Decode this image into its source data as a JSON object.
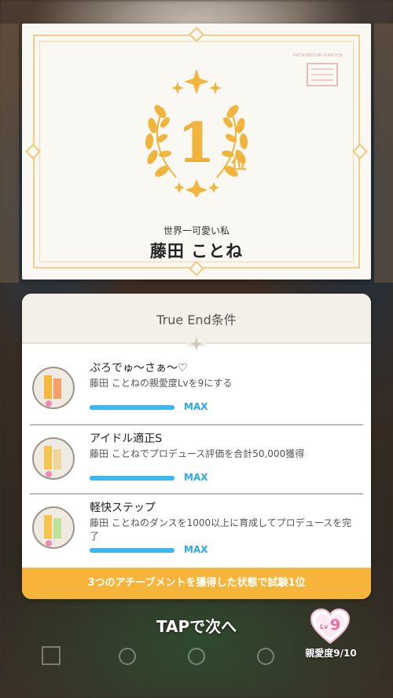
{
  "certificate": {
    "stamp_text": "HATSUBOSHI GAKUEN",
    "rank_number": "1",
    "rank_suffix": "位",
    "subtitle": "世界一可愛い私",
    "name": "藤田 ことね"
  },
  "panel": {
    "title": "True End条件",
    "achievements": [
      {
        "title": "ぷろでゅ～さぁ～♡",
        "description": "藤田 ことねの親愛度Lvを9にする",
        "progress": 1.0,
        "status": "MAX",
        "icon": "medal-icon"
      },
      {
        "title": "アイドル適正S",
        "description": "藤田 ことねでプロデュース評価を合計50,000獲得",
        "progress": 1.0,
        "status": "MAX",
        "icon": "medal-icon"
      },
      {
        "title": "軽快ステップ",
        "description": "藤田 ことねのダンスを1000以上に育成してプロデュースを完了",
        "progress": 1.0,
        "status": "MAX",
        "icon": "medal-icon"
      }
    ],
    "footer": "3つのアチーブメントを獲得した状態で試験1位"
  },
  "bottom": {
    "tap_next": "TAPで次へ",
    "affinity_lv_prefix": "Lv",
    "affinity_lv": "9",
    "affinity_label": "親愛度9/10"
  },
  "colors": {
    "gold": "#f1b53e",
    "progress_blue": "#3db7ef",
    "footer_orange": "#f6b43a",
    "heart_pink": "#e56fa0"
  }
}
